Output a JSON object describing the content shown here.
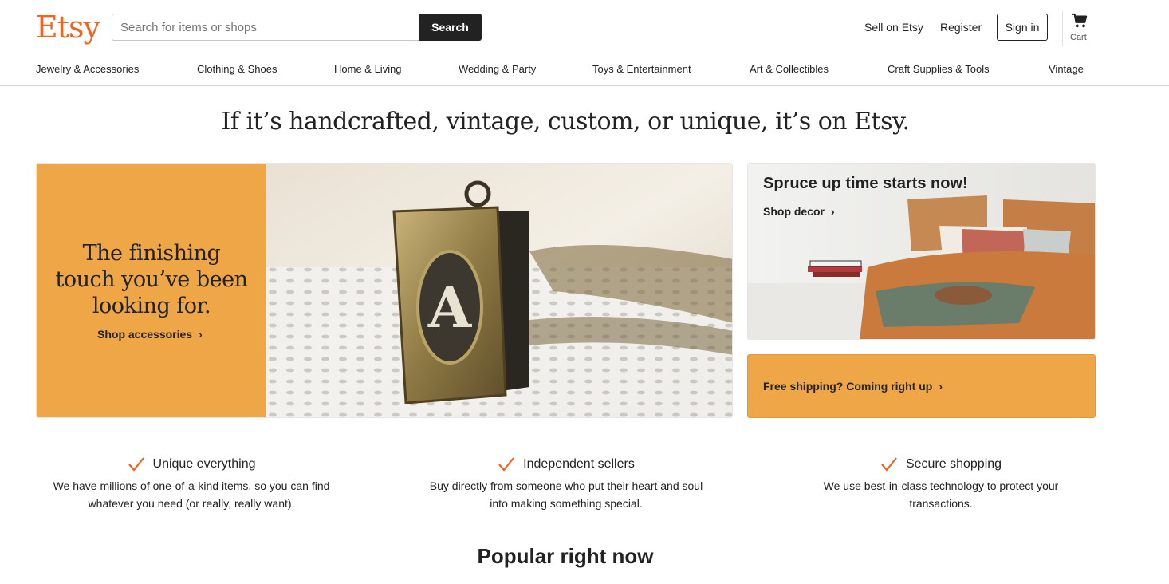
{
  "brand": {
    "name": "Etsy",
    "color": "#f1641e"
  },
  "search": {
    "placeholder": "Search for items or shops",
    "button_label": "Search"
  },
  "header": {
    "sell_label": "Sell on Etsy",
    "register_label": "Register",
    "signin_label": "Sign in",
    "cart_label": "Cart",
    "cart_icon": "cart-icon"
  },
  "categories": [
    "Jewelry & Accessories",
    "Clothing & Shoes",
    "Home & Living",
    "Wedding & Party",
    "Toys & Entertainment",
    "Art & Collectibles",
    "Craft Supplies & Tools",
    "Vintage"
  ],
  "headline": "If it’s handcrafted, vintage, custom, or unique, it’s on Etsy.",
  "hero": {
    "title": "The finishing touch you’ve been looking for.",
    "link_label": "Shop accessories",
    "accent": "#eea646"
  },
  "decor_card": {
    "title": "Spruce up time starts now!",
    "link_label": "Shop decor"
  },
  "shipping_card": {
    "link_label": "Free shipping? Coming right up"
  },
  "values": [
    {
      "title": "Unique everything",
      "description": "We have millions of one-of-a-kind items, so you can find whatever you need (or really, really want)."
    },
    {
      "title": "Independent sellers",
      "description": "Buy directly from someone who put their heart and soul into making something special."
    },
    {
      "title": "Secure shopping",
      "description": "We use best-in-class technology to protect your transactions."
    }
  ],
  "popular_heading": "Popular right now"
}
